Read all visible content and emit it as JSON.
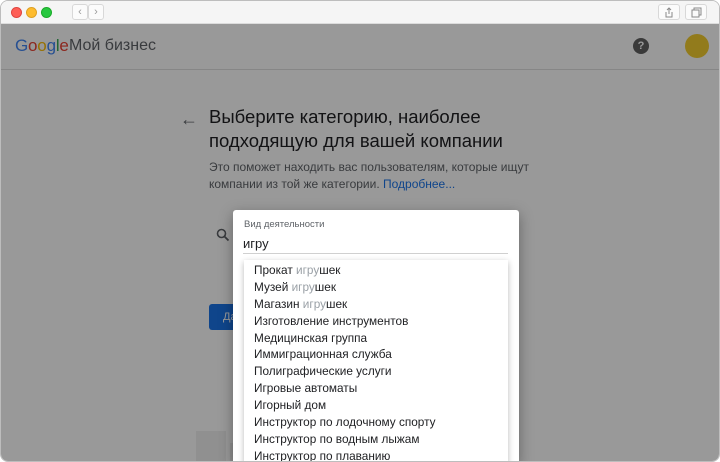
{
  "app": {
    "logo": "Google",
    "product": "Мой бизнес"
  },
  "page": {
    "heading": "Выберите категорию, наиболее подходящую для вашей компании",
    "subtext": "Это поможет находить вас пользователям, которые ищут компании из той же категории.",
    "learn_more": "Подробнее...",
    "next_button": "Далее"
  },
  "dialog": {
    "label": "Вид деятельности",
    "value": "игру",
    "suggestions": [
      {
        "before": "Прокат ",
        "match": "игру",
        "after": "шек"
      },
      {
        "before": "Музей ",
        "match": "игру",
        "after": "шек"
      },
      {
        "before": "Магазин ",
        "match": "игру",
        "after": "шек"
      },
      {
        "before": "Изготовление инструментов",
        "match": "",
        "after": ""
      },
      {
        "before": "Медицинская группа",
        "match": "",
        "after": ""
      },
      {
        "before": "Иммиграционная служба",
        "match": "",
        "after": ""
      },
      {
        "before": "Полиграфические услуги",
        "match": "",
        "after": ""
      },
      {
        "before": "Игровые автоматы",
        "match": "",
        "after": ""
      },
      {
        "before": "Игорный дом",
        "match": "",
        "after": ""
      },
      {
        "before": "Инструктор по лодочному спорту",
        "match": "",
        "after": ""
      },
      {
        "before": "Инструктор по водным лыжам",
        "match": "",
        "after": ""
      },
      {
        "before": "Инструктор по плаванию",
        "match": "",
        "after": ""
      }
    ]
  },
  "icons": {
    "back_nav": "chevron-left-icon",
    "forward_nav": "chevron-right-icon",
    "share": "share-icon",
    "tabs": "tabs-icon",
    "help": "help-icon",
    "back_arrow": "arrow-left-icon",
    "search": "search-icon"
  },
  "colors": {
    "accent": "#1a73e8",
    "avatar": "#f4cd30",
    "match_highlight": "#9aa0a6"
  }
}
